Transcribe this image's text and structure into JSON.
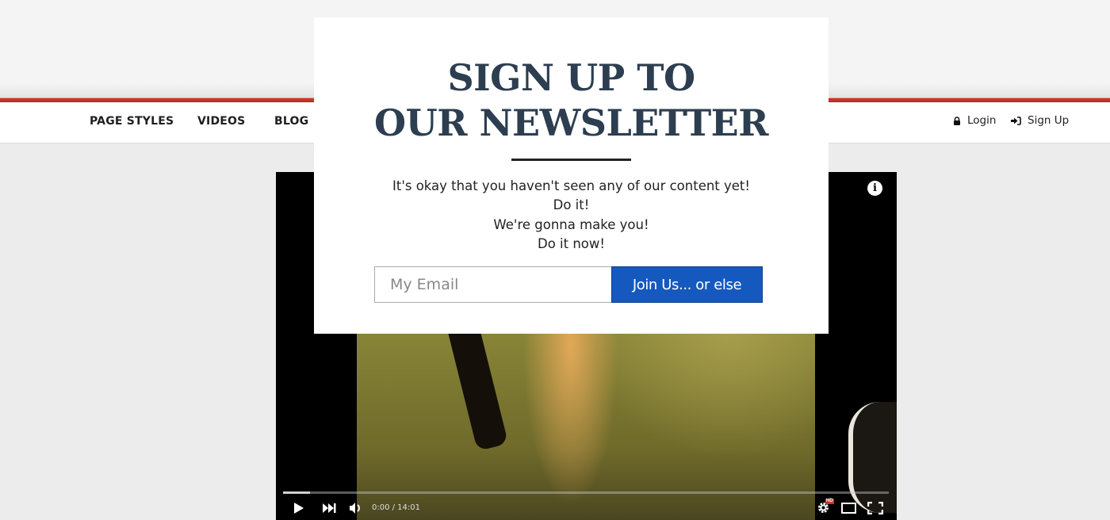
{
  "nav": {
    "items": [
      {
        "label": "PAGE STYLES"
      },
      {
        "label": "VIDEOS"
      },
      {
        "label": "BLOG"
      }
    ],
    "right": {
      "login": {
        "label": "Login",
        "icon": "lock-icon"
      },
      "signup": {
        "label": "Sign Up",
        "icon": "sign-in-icon"
      }
    }
  },
  "video": {
    "info_icon": "i",
    "time_display": "0:00 / 14:01",
    "progress_buffered_fraction": 0.045,
    "hd_badge": "HD",
    "controls": {
      "play": "▶",
      "next": "⏭",
      "volume": "volume-icon",
      "settings": "gear-icon",
      "theater": "theater-mode-icon",
      "fullscreen": "fullscreen-icon"
    }
  },
  "modal": {
    "title_line1": "SIGN UP TO",
    "title_line2": "OUR NEWSLETTER",
    "body_lines": [
      "It's okay that you haven't seen any of our content yet!",
      "Do it!",
      "We're gonna make you!",
      "Do it now!"
    ],
    "email_placeholder": "My Email",
    "email_value": "",
    "submit_label": "Join Us... or else"
  },
  "colors": {
    "accent_red": "#c0392b",
    "button_blue": "#1559be",
    "title_navy": "#2c3e50"
  }
}
